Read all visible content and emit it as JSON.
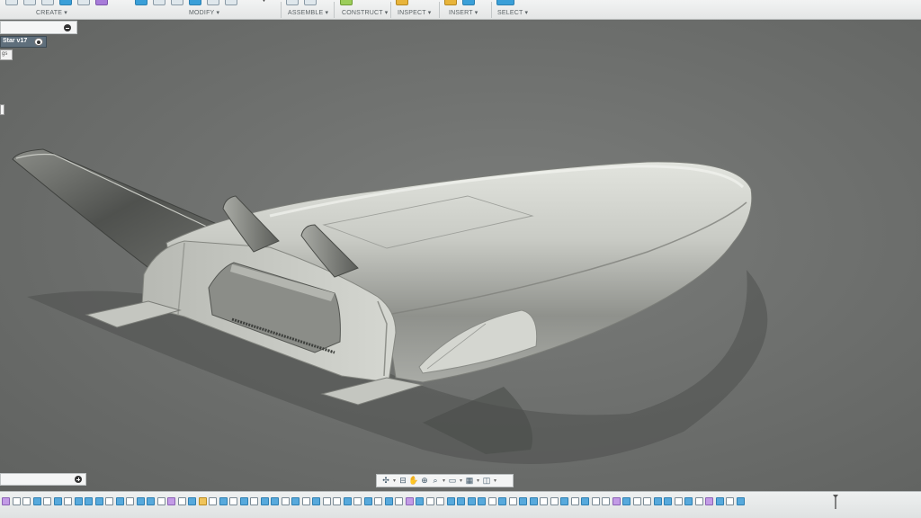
{
  "toolbar": {
    "groups": [
      {
        "label": "CREATE ▾"
      },
      {
        "label": "MODIFY ▾"
      },
      {
        "label": "ASSEMBLE ▾"
      },
      {
        "label": "CONSTRUCT ▾"
      },
      {
        "label": "INSPECT ▾"
      },
      {
        "label": "INSERT ▾"
      },
      {
        "label": "SELECT ▾"
      }
    ]
  },
  "browser": {
    "document_name": "Star v17",
    "settings_label": "gs"
  },
  "colors": {
    "viewport_background": "#6d6f6d",
    "toolbar_background": "#eceeee",
    "timeline_feature": "#57a9dc",
    "model_surface": "#c9cbc5"
  },
  "navbar": {
    "icons": [
      "orbit-icon",
      "look-at-icon",
      "pan-icon",
      "zoom-icon",
      "fit-icon",
      "display-settings-icon",
      "grid-icon",
      "viewports-icon"
    ]
  },
  "timeline": {
    "icons": [
      "play-controls-icon",
      "sketch-feature-icon",
      "extrude-feature-icon",
      "move-feature-icon",
      "combine-feature-icon",
      "timeline-marker-icon"
    ]
  }
}
